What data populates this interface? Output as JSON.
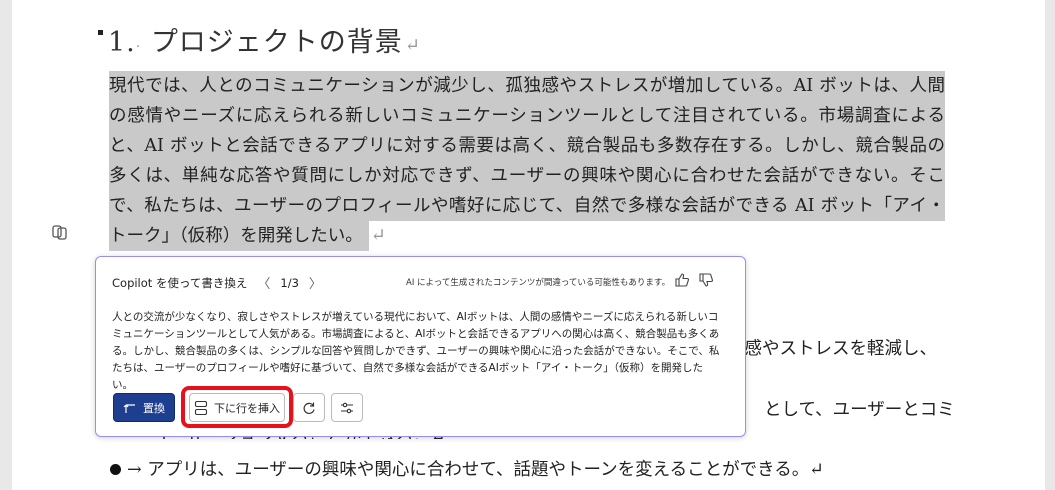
{
  "heading": {
    "number": "1.",
    "text": "プロジェクトの背景"
  },
  "paragraph_lines": [
    "現代では、人とのコミュニケーションが減少し、孤独感やストレスが増加している。AI ボットは、人間",
    "の感情やニーズに応えられる新しいコミュニケーションツールとして注目されている。市場調査による",
    "と、AI ボットと会話できるアプリに対する需要は高く、競合製品も多数存在する。しかし、競合製品の",
    "多くは、単純な応答や質問にしか対応できず、ユーザーの興味や関心に合わせた会話ができない。そこ",
    "で、私たちは、ユーザーのプロフィールや嗜好に応じて、自然で多様な会話ができる AI ボット「アイ・",
    "トーク」（仮称）を開発したい。"
  ],
  "paragraph_mark": "↵",
  "background_text": {
    "line1_right": "独感やストレスを軽減し、",
    "line2_right": "として、ユーザーとコミ",
    "line3": "ユーザーションすることができる。↵",
    "bullet_text": "→ アプリは、ユーザーの興味や関心に合わせて、話題やトーンを変えることができる。↵"
  },
  "copilot_panel": {
    "title": "Copilot を使って書き換え",
    "prev": "〈",
    "pager": "1/3",
    "next": "〉",
    "disclaimer": "AI によって生成されたコンテンツが間違っている可能性もあります。",
    "body": "人との交流が少なくなり、寂しさやストレスが増えている現代において、AIボットは、人間の感情やニーズに応えられる新しいコミュニケーションツールとして人気がある。市場調査によると、AIボットと会話できるアプリへの関心は高く、競合製品も多くある。しかし、競合製品の多くは、シンプルな回答や質問しかできず、ユーザーの興味や関心に沿った会話ができない。そこで、私たちは、ユーザーのプロフィールや嗜好に基づいて、自然で多様な会話ができるAIボット「アイ・トーク」（仮称）を開発したい。",
    "replace_label": "置換",
    "insert_below_label": "下に行を挿入"
  },
  "icons": {
    "thumbs_up": "thumbs-up-icon",
    "thumbs_down": "thumbs-down-icon",
    "regenerate": "refresh-icon",
    "adjust": "sliders-icon",
    "copilot": "copilot-icon"
  },
  "colors": {
    "highlight": "#c9c9c9",
    "primary_button": "#1e3f8f",
    "callout": "#e8101a",
    "panel_border": "#9b8cf0"
  }
}
